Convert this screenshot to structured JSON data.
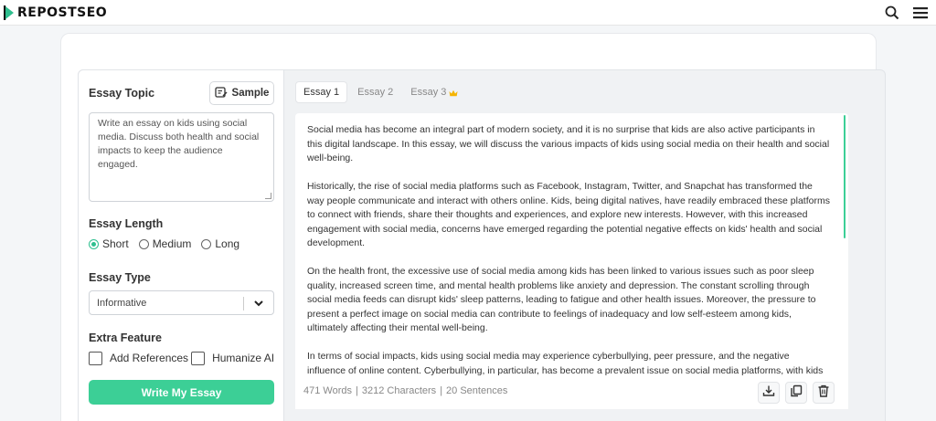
{
  "header": {
    "logo_text": "REPOSTSEO",
    "search_icon": "search-icon",
    "menu_icon": "hamburger-menu-icon"
  },
  "colors": {
    "accent": "#3ccf96",
    "border": "#e1e4e8"
  },
  "form": {
    "topic_label": "Essay Topic",
    "sample_label": "Sample",
    "topic_text": "Write an essay on kids using social media. Discuss both health and social impacts to keep the audience engaged.",
    "length_label": "Essay Length",
    "length_options": [
      "Short",
      "Medium",
      "Long"
    ],
    "length_selected": "Short",
    "type_label": "Essay Type",
    "type_value": "Informative",
    "extra_label": "Extra Feature",
    "extra_options": [
      "Add References",
      "Humanize AI"
    ],
    "submit_label": "Write My Essay"
  },
  "tabs": [
    {
      "label": "Essay 1",
      "active": true
    },
    {
      "label": "Essay 2",
      "active": false
    },
    {
      "label": "Essay 3",
      "active": false,
      "badge": "crown-icon"
    }
  ],
  "essay": {
    "paragraphs": [
      "Social media has become an integral part of modern society, and it is no surprise that kids are also active participants in this digital landscape. In this essay, we will discuss the various impacts of kids using social media on their health and social well-being.",
      "Historically, the rise of social media platforms such as Facebook, Instagram, Twitter, and Snapchat has transformed the way people communicate and interact with others online. Kids, being digital natives, have readily embraced these platforms to connect with friends, share their thoughts and experiences, and explore new interests. However, with this increased engagement with social media, concerns have emerged regarding the potential negative effects on kids' health and social development.",
      "On the health front, the excessive use of social media among kids has been linked to various issues such as poor sleep quality, increased screen time, and mental health problems like anxiety and depression. The constant scrolling through social media feeds can disrupt kids' sleep patterns, leading to fatigue and other health issues. Moreover, the pressure to present a perfect image on social media can contribute to feelings of inadequacy and low self-esteem among kids, ultimately affecting their mental well-being.",
      "In terms of social impacts, kids using social media may experience cyberbullying, peer pressure, and the negative influence of online content. Cyberbullying, in particular, has become a prevalent issue on social media platforms, with kids facing harassment, exclusion, and threats from others online, impacting their self-esteem and mental health."
    ],
    "stats": {
      "words": "471 Words",
      "sep1": "|",
      "characters": "3212 Characters",
      "sep2": "|",
      "sentences": "20 Sentences"
    },
    "actions": [
      "download-icon",
      "copy-icon",
      "trash-icon"
    ]
  }
}
